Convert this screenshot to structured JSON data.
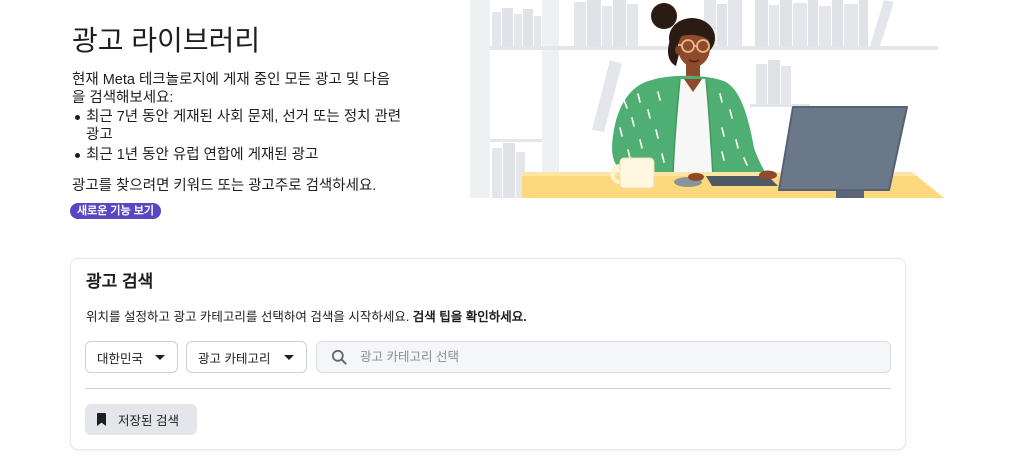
{
  "header": {
    "title": "광고 라이브러리",
    "intro": "현재 Meta 테크놀로지에 게재 중인 모든 광고 및 다음을 검색해보세요:",
    "bullets": [
      "최근 7년 동안 게재된 사회 문제, 선거 또는 정치 관련 광고",
      "최근 1년 동안 유럽 연합에 게재된 광고"
    ],
    "hint": "광고를 찾으려면 키워드 또는 광고주로 검색하세요.",
    "badge_label": "새로운 기능 보기"
  },
  "search_card": {
    "title": "광고 검색",
    "description": "위치를 설정하고 광고 카테고리를 선택하여 검색을 시작하세요.",
    "tips_link": "검색 팁을 확인하세요.",
    "country_select": {
      "value": "대한민국",
      "icon": "caret-down-icon"
    },
    "category_select": {
      "value": "광고 카테고리",
      "icon": "caret-down-icon"
    },
    "search_input": {
      "placeholder": "광고 카테고리 선택",
      "icon": "search-icon"
    },
    "saved_search_button": {
      "label": "저장된 검색",
      "icon": "bookmark-icon"
    }
  },
  "colors": {
    "text_primary": "#1c1e21",
    "text_placeholder": "#8a8d91",
    "badge_bg": "#5a46c3",
    "badge_text": "#ffffff",
    "border": "#ccd0d5",
    "search_bg": "#f5f6f7",
    "button_bg": "#e4e6eb",
    "icon_gray": "#65676b"
  }
}
